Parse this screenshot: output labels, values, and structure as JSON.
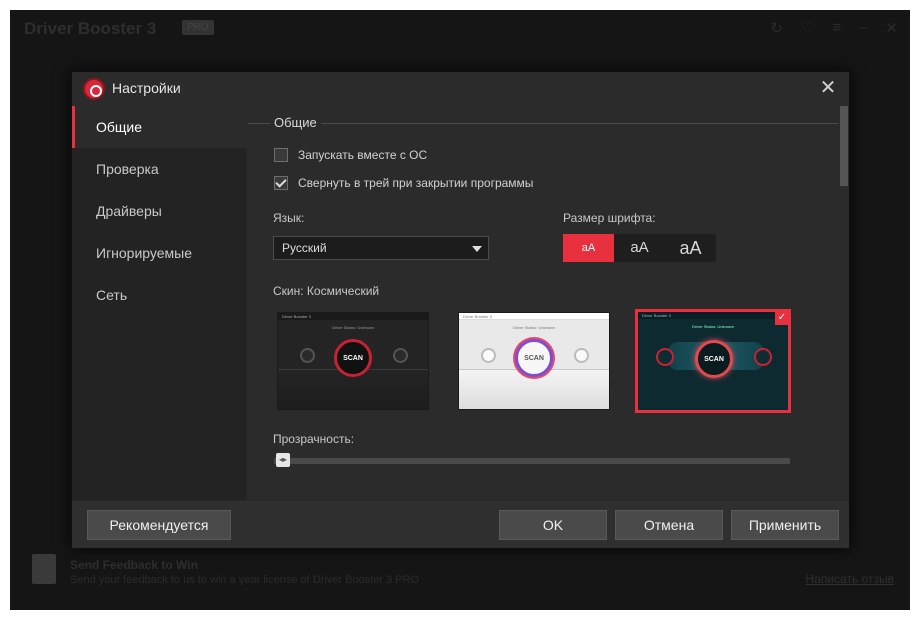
{
  "app": {
    "title": "Driver Booster 3",
    "badge": "PRO",
    "feedback_title": "Send Feedback to Win",
    "feedback_text": "Send your feedback to us to win a year license of Driver Booster 3 PRO",
    "feedback_link": "Написать отзыв"
  },
  "dialog": {
    "title": "Настройки"
  },
  "sidebar": {
    "items": [
      {
        "label": "Общие",
        "active": true
      },
      {
        "label": "Проверка",
        "active": false
      },
      {
        "label": "Драйверы",
        "active": false
      },
      {
        "label": "Игнорируемые",
        "active": false
      },
      {
        "label": "Сеть",
        "active": false
      }
    ]
  },
  "general": {
    "section_title": "Общие",
    "startup_label": "Запускать вместе с ОС",
    "startup_checked": false,
    "tray_label": "Свернуть в трей при закрытии программы",
    "tray_checked": true,
    "language_label": "Язык:",
    "language_value": "Русский",
    "font_size_label": "Размер шрифта:",
    "font_sizes": [
      "aA",
      "aA",
      "aA"
    ],
    "font_size_selected": 0,
    "skin_label": "Скин: Космический",
    "skins": [
      {
        "name": "Dark",
        "mini_title": "Driver Booster 3",
        "status": "Driver Status: Unknown",
        "scan": "SCAN",
        "selected": false
      },
      {
        "name": "Light",
        "mini_title": "Driver Booster 3",
        "status": "Driver Status: Unknown",
        "scan": "SCAN",
        "selected": false
      },
      {
        "name": "Space",
        "mini_title": "Driver Booster 3",
        "status": "Driver Status: Unknown",
        "scan": "SCAN",
        "selected": true
      }
    ],
    "transparency_label": "Прозрачность:",
    "transparency_value": 0
  },
  "footer": {
    "recommended": "Рекомендуется",
    "ok": "OK",
    "cancel": "Отмена",
    "apply": "Применить"
  },
  "colors": {
    "accent": "#e8303f",
    "dialog_bg": "#2b2b2b",
    "sidebar_bg": "#232323"
  }
}
